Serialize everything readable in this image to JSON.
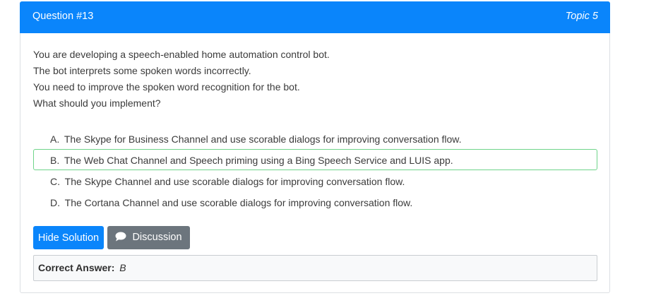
{
  "header": {
    "question_number": "Question #13",
    "topic": "Topic 5"
  },
  "question": {
    "lines": [
      "You are developing a speech-enabled home automation control bot.",
      "The bot interprets some spoken words incorrectly.",
      "You need to improve the spoken word recognition for the bot.",
      "What should you implement?"
    ]
  },
  "choices": [
    {
      "letter": "A.",
      "text": "The Skype for Business Channel and use scorable dialogs for improving conversation flow."
    },
    {
      "letter": "B.",
      "text": "The Web Chat Channel and Speech priming using a Bing Speech Service and LUIS app."
    },
    {
      "letter": "C.",
      "text": "The Skype Channel and use scorable dialogs for improving conversation flow."
    },
    {
      "letter": "D.",
      "text": "The Cortana Channel and use scorable dialogs for improving conversation flow."
    }
  ],
  "buttons": {
    "hide_solution": "Hide Solution",
    "discussion": "Discussion",
    "discussion_icon": "chat-bubble-icon"
  },
  "answer": {
    "label": "Correct Answer:",
    "value": "B"
  },
  "colors": {
    "primary": "#0a85fb",
    "secondary": "#6c757d",
    "correct_border": "#6fd48a"
  }
}
